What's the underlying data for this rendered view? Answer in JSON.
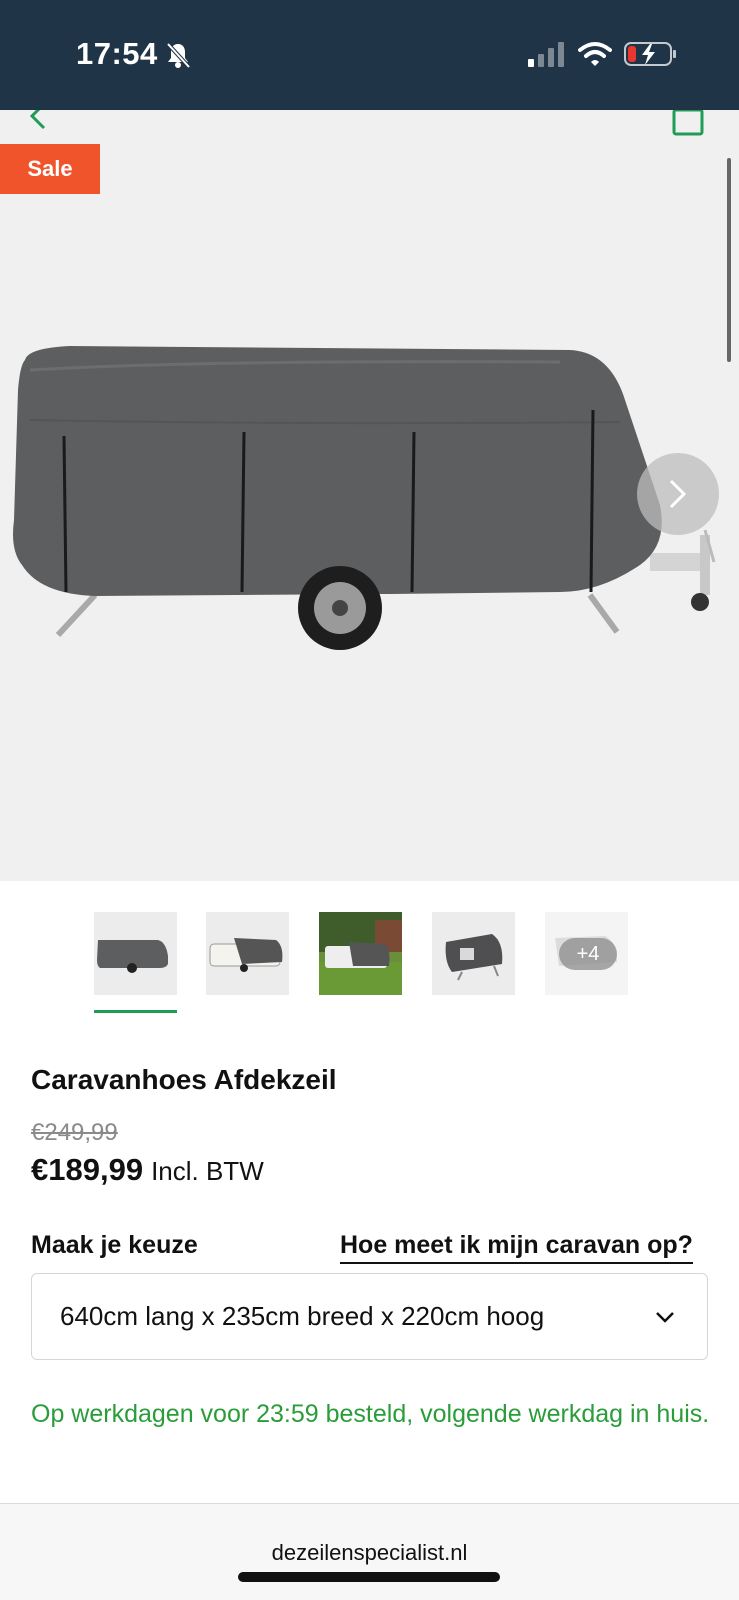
{
  "status_bar": {
    "time": "17:54",
    "icons": [
      "bell-slash-icon",
      "signal-icon",
      "wifi-icon",
      "battery-charging-icon"
    ]
  },
  "gallery": {
    "sale_label": "Sale",
    "photo": "grey-caravan-cover-photo",
    "icons": [
      "back-icon",
      "share-icon",
      "chevron-right-icon"
    ]
  },
  "thumbnails": {
    "items": [
      "grey-cover-side-view",
      "caravan-partially-covered",
      "covered-caravan-on-lawn",
      "cover-detail-view"
    ],
    "more_label": "+4",
    "selected_index": 0
  },
  "product": {
    "title": "Caravanhoes Afdekzeil",
    "old_price": "€249,99",
    "new_price": "€189,99",
    "price_note": "Incl. BTW"
  },
  "options": {
    "choice_label": "Maak je keuze",
    "measure_link": "Hoe meet ik mijn caravan op?",
    "selected_size": "640cm lang x 235cm breed x 220cm hoog"
  },
  "delivery": {
    "text": "Op werkdagen voor 23:59 besteld, volgende werkdag in huis."
  },
  "browser": {
    "url": "dezeilenspecialist.nl"
  },
  "colors": {
    "status_bar_bg": "#203447",
    "sale_badge": "#f0542b",
    "accent_green": "#1f9d57",
    "delivery_green": "#2a9d3a"
  }
}
